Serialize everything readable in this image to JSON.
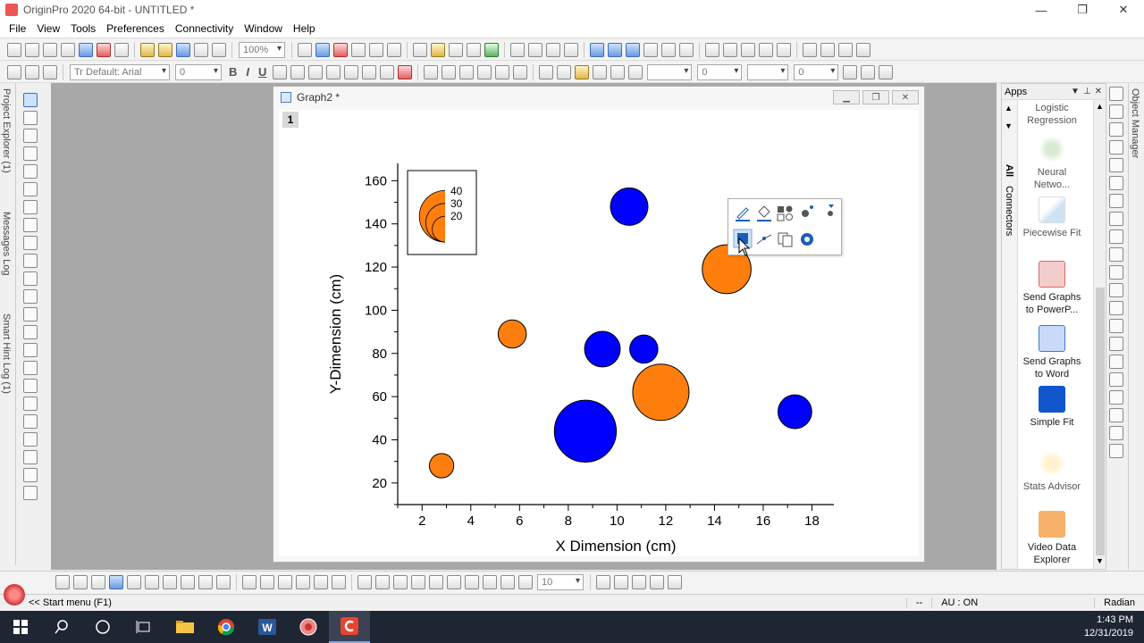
{
  "window": {
    "title": "OriginPro 2020 64-bit - UNTITLED *",
    "controls": {
      "minimize": "—",
      "maximize": "❐",
      "close": "✕"
    }
  },
  "menu": [
    "File",
    "View",
    "Tools",
    "Preferences",
    "Connectivity",
    "Window",
    "Help"
  ],
  "toolbar1": {
    "zoom": "100%"
  },
  "toolbar2": {
    "font_name": "Tr Default: Arial",
    "font_size": "0",
    "bold": "B",
    "italic": "I",
    "underline": "U",
    "line_width": "0",
    "pattern_size": "0"
  },
  "left_dock_tabs": [
    "Project Explorer (1)",
    "Messages Log",
    "Smart Hint Log (1)"
  ],
  "right_dock_tabs": [
    "Object Manager"
  ],
  "graph_window": {
    "title": "Graph2 *",
    "layer": "1",
    "buttons": {
      "minimize": "▁",
      "restore": "❐",
      "close": "✕"
    }
  },
  "chart_data": {
    "type": "scatter",
    "subtype": "bubble",
    "xlabel": "X Dimension (cm)",
    "ylabel": "Y-Dimension (cm)",
    "xlim": [
      1.0,
      18.9
    ],
    "ylim": [
      10.0,
      168.0
    ],
    "xticks": [
      2,
      4,
      6,
      8,
      10,
      12,
      14,
      16,
      18
    ],
    "yticks": [
      20,
      40,
      60,
      80,
      100,
      120,
      140,
      160
    ],
    "colors": {
      "orange": "#ff7f0e",
      "blue": "#0000ff"
    },
    "points": [
      {
        "x": 10.5,
        "y": 148,
        "size": 20,
        "color": "blue"
      },
      {
        "x": 14.5,
        "y": 119,
        "size": 26,
        "color": "orange"
      },
      {
        "x": 5.7,
        "y": 89,
        "size": 15,
        "color": "orange"
      },
      {
        "x": 9.4,
        "y": 82,
        "size": 19,
        "color": "blue"
      },
      {
        "x": 11.1,
        "y": 82,
        "size": 15,
        "color": "blue"
      },
      {
        "x": 11.8,
        "y": 62,
        "size": 30,
        "color": "orange"
      },
      {
        "x": 8.7,
        "y": 44,
        "size": 33,
        "color": "blue"
      },
      {
        "x": 17.3,
        "y": 53,
        "size": 18,
        "color": "blue"
      },
      {
        "x": 2.8,
        "y": 28,
        "size": 13,
        "color": "orange"
      }
    ],
    "legend": {
      "labels": [
        "40",
        "30",
        "20"
      ],
      "values": [
        40,
        30,
        20
      ]
    }
  },
  "mini_toolbar": {
    "icons": [
      "edit-icon",
      "fill-icon",
      "shapes-icon",
      "scatter-icon",
      "dropdown-icon",
      "bubble-color-icon",
      "line-symbol-icon",
      "copy-format-icon",
      "settings-icon"
    ]
  },
  "apps_panel": {
    "title": "Apps",
    "controls": {
      "dropdown": "▼",
      "pin": "⊥",
      "close": "✕"
    },
    "tabs": [
      "All",
      "Connectors"
    ],
    "items": [
      {
        "label": "Logistic Regression",
        "color": "#888888"
      },
      {
        "label": "Neural Netwo...",
        "color": "#b6d7a8"
      },
      {
        "label": "Piecewise Fit",
        "color": "#9fc5e8"
      },
      {
        "label": "Send Graphs to PowerP...",
        "color": "#e06666"
      },
      {
        "label": "Send Graphs to Word",
        "color": "#3c78d8"
      },
      {
        "label": "Simple Fit",
        "color": "#1155cc"
      },
      {
        "label": "Stats Advisor",
        "color": "#ffe599"
      },
      {
        "label": "Video Data Explorer",
        "color": "#e69138"
      }
    ]
  },
  "bottom_toolbar": {
    "font_size": "10"
  },
  "status": {
    "start": "<< Start menu (F1)",
    "sep": "--",
    "au": "AU : ON",
    "units": "Radian"
  },
  "taskbar": {
    "time": "1:43 PM",
    "date": "12/31/2019"
  }
}
